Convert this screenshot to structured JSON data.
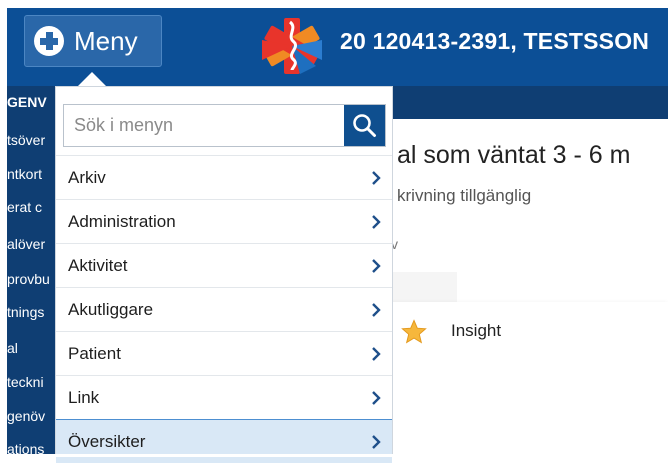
{
  "header": {
    "menu_label": "Meny",
    "patient": "20 120413-2391,  TESTSSON"
  },
  "leftnav": {
    "items": [
      "GENV",
      "tsöver",
      "ntkort",
      "erat c",
      "alöver",
      "provbu",
      "tnings",
      "al",
      "teckni",
      "genöv",
      "ations"
    ]
  },
  "content": {
    "title": "al som väntat 3 - 6 m",
    "subtitle": "krivning tillgänglig",
    "small": "v"
  },
  "menu": {
    "search_placeholder": "Sök i menyn",
    "items": [
      {
        "label": "Arkiv"
      },
      {
        "label": "Administration"
      },
      {
        "label": "Aktivitet"
      },
      {
        "label": "Akutliggare"
      },
      {
        "label": "Patient"
      },
      {
        "label": "Link"
      },
      {
        "label": "Översikter"
      }
    ]
  },
  "submenu": {
    "items": [
      {
        "label": "Insight"
      }
    ]
  },
  "colors": {
    "header": "#0c4f96",
    "menu_button": "#2a67a9",
    "leftnav": "#0f3e73",
    "active_item": "#d9e8f6",
    "search_button": "#0f4f8f",
    "star": "#f6b73c"
  }
}
